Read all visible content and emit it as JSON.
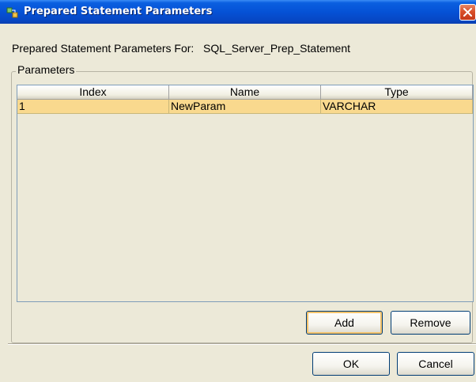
{
  "window": {
    "title": "Prepared Statement Parameters",
    "titlebar_color": "#0552d6",
    "close_icon": "close-icon"
  },
  "header": {
    "label": "Prepared Statement Parameters For:",
    "statement_name": "SQL_Server_Prep_Statement"
  },
  "parameters": {
    "legend": "Parameters",
    "columns": [
      "Index",
      "Name",
      "Type"
    ],
    "rows": [
      [
        "1",
        "NewParam",
        "VARCHAR"
      ]
    ],
    "selected_row_color": "#f9d98e",
    "add_label": "Add",
    "remove_label": "Remove"
  },
  "footer": {
    "ok_label": "OK",
    "cancel_label": "Cancel"
  }
}
